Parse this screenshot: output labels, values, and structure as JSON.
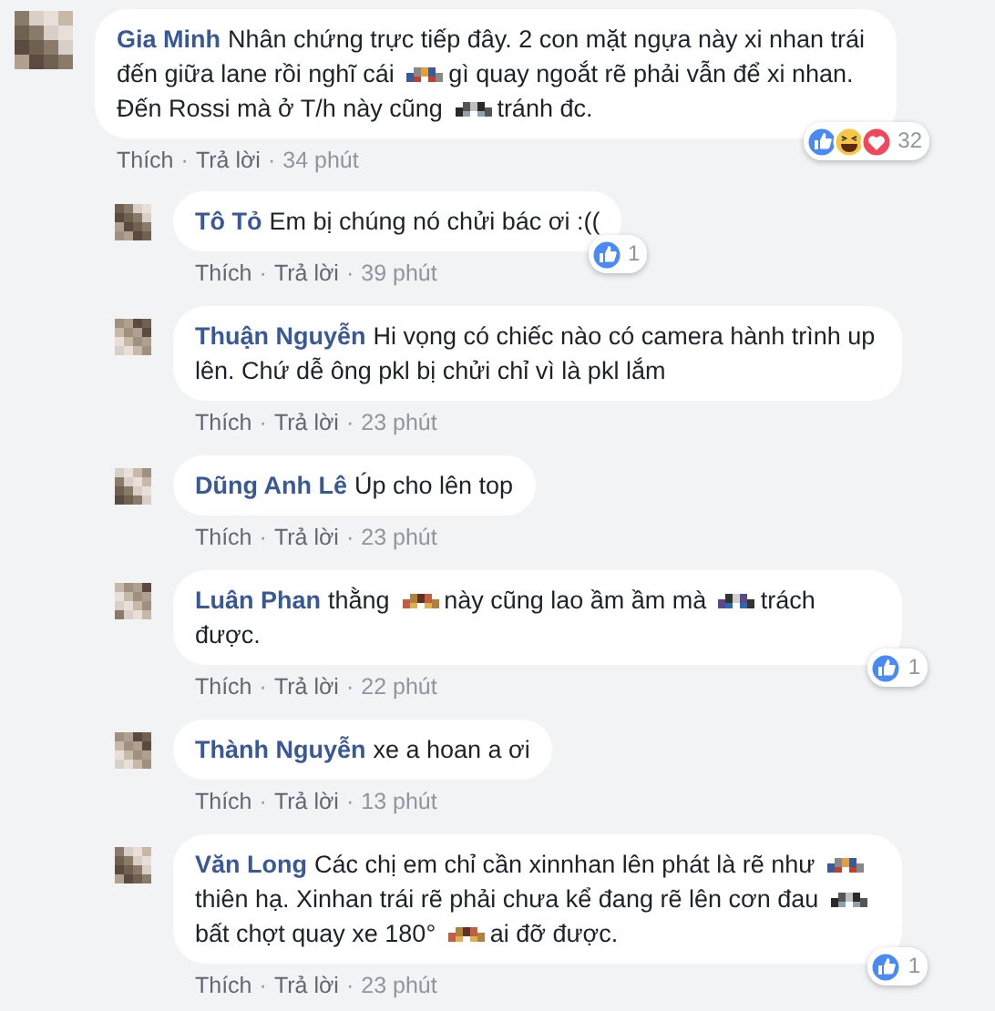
{
  "separator": "·",
  "comments": [
    {
      "author": "Gia Minh",
      "segments": [
        {
          "kind": "text",
          "text": "Nhân chứng trực tiếp đây. 2 con mặt ngựa này xi nhan trái đến giữa lane rồi nghĩ cái"
        },
        {
          "kind": "censor"
        },
        {
          "kind": "text",
          "text": "gì quay ngoắt rẽ phải vẫn để xi nhan. Đến Rossi mà ở T/h này cũng"
        },
        {
          "kind": "censor"
        },
        {
          "kind": "text",
          "text": "tránh đc."
        }
      ],
      "reactions": {
        "icons": [
          {
            "kind": "like"
          },
          {
            "kind": "haha"
          },
          {
            "kind": "love"
          }
        ],
        "count": "32"
      },
      "actions": [
        "Thích",
        "Trả lời"
      ],
      "time": "34 phút",
      "replies": [
        {
          "author": "Tô Tỏ",
          "segments": [
            {
              "kind": "text",
              "text": "Em bị chúng nó chửi bác ơi :(("
            }
          ],
          "reactions": {
            "icons": [
              {
                "kind": "like"
              }
            ],
            "count": "1"
          },
          "actions": [
            "Thích",
            "Trả lời"
          ],
          "time": "39 phút"
        },
        {
          "author": "Thuận Nguyễn",
          "segments": [
            {
              "kind": "text",
              "text": "Hi vọng có chiếc nào có camera hành trình up lên. Chứ dễ ông pkl bị chửi chỉ vì là pkl lắm"
            }
          ],
          "actions": [
            "Thích",
            "Trả lời"
          ],
          "time": "23 phút"
        },
        {
          "author": "Dũng Anh Lê",
          "segments": [
            {
              "kind": "text",
              "text": "Úp cho lên top"
            }
          ],
          "actions": [
            "Thích",
            "Trả lời"
          ],
          "time": "23 phút"
        },
        {
          "author": "Luân Phan",
          "segments": [
            {
              "kind": "text",
              "text": "thằng"
            },
            {
              "kind": "censor"
            },
            {
              "kind": "text",
              "text": "này cũng lao ầm ầm mà"
            },
            {
              "kind": "censor"
            },
            {
              "kind": "text",
              "text": "trách được."
            }
          ],
          "reactions": {
            "icons": [
              {
                "kind": "like"
              }
            ],
            "count": "1"
          },
          "actions": [
            "Thích",
            "Trả lời"
          ],
          "time": "22 phút"
        },
        {
          "author": "Thành Nguyễn",
          "segments": [
            {
              "kind": "text",
              "text": "xe a hoan a ơi"
            }
          ],
          "actions": [
            "Thích",
            "Trả lời"
          ],
          "time": "13 phút"
        },
        {
          "author": "Văn Long",
          "segments": [
            {
              "kind": "text",
              "text": "Các chị em chỉ cần xinnhan lên phát là rẽ như"
            },
            {
              "kind": "censor"
            },
            {
              "kind": "text",
              "text": "thiên hạ. Xinhan trái rẽ phải chưa kể đang rẽ lên cơn đau"
            },
            {
              "kind": "censor"
            },
            {
              "kind": "text",
              "text": "bất chợt quay xe 180°"
            },
            {
              "kind": "censor"
            },
            {
              "kind": "text",
              "text": "ai đỡ được."
            }
          ],
          "reactions": {
            "icons": [
              {
                "kind": "like"
              }
            ],
            "count": "1"
          },
          "actions": [
            "Thích",
            "Trả lời"
          ],
          "time": "23 phút"
        }
      ]
    }
  ]
}
